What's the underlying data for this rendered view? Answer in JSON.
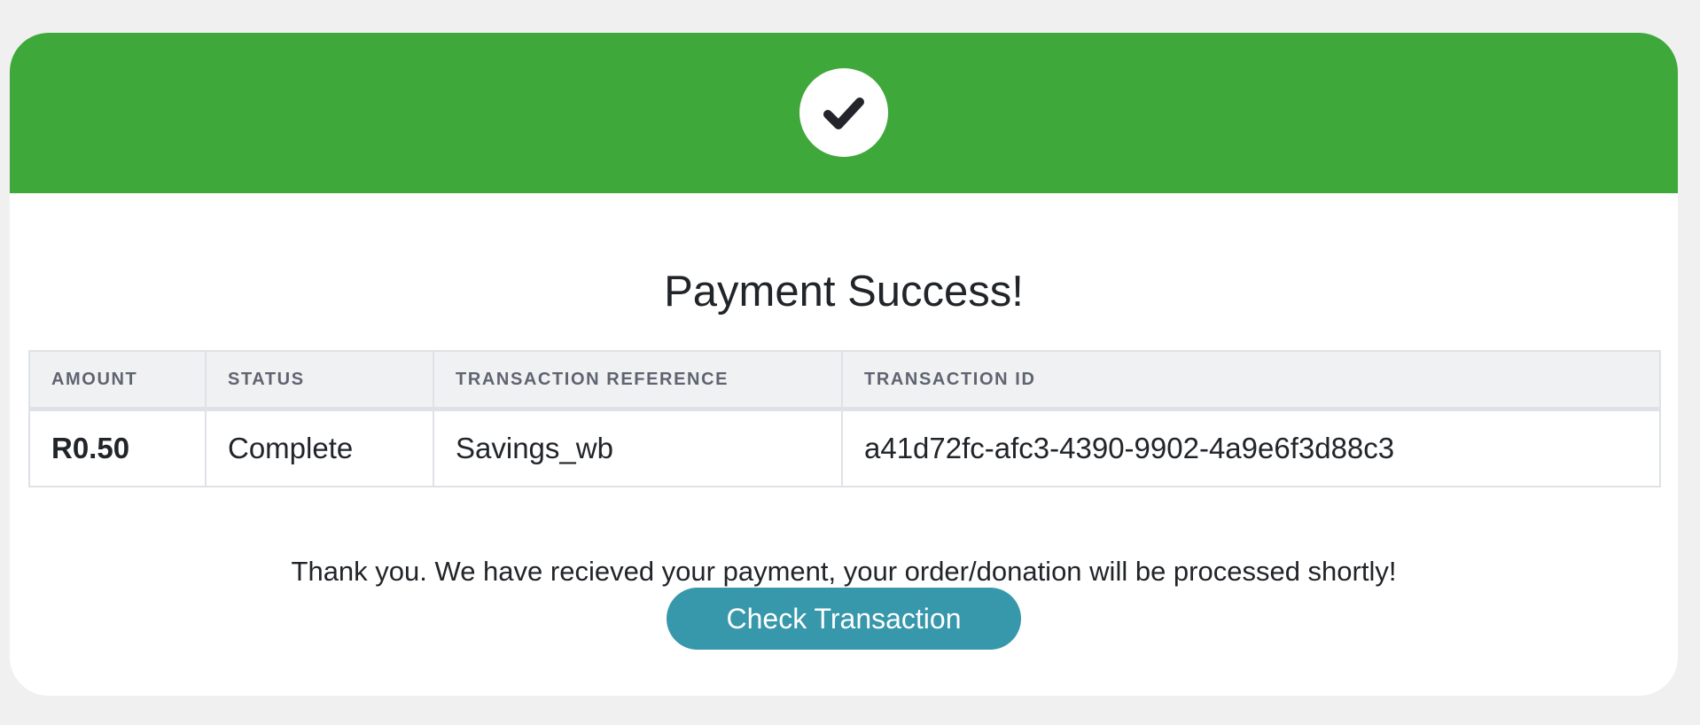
{
  "header": {
    "icon": "checkmark-icon",
    "banner_color": "#3ea83a"
  },
  "title": "Payment Success!",
  "table": {
    "headers": [
      "AMOUNT",
      "STATUS",
      "TRANSACTION REFERENCE",
      "TRANSACTION ID"
    ],
    "row": {
      "amount": "R0.50",
      "status": "Complete",
      "reference": "Savings_wb",
      "transaction_id": "a41d72fc-afc3-4390-9902-4a9e6f3d88c3"
    }
  },
  "message": "Thank you. We have recieved your payment, your order/donation will be processed shortly!",
  "button": {
    "label": "Check Transaction",
    "color": "#3797ab"
  }
}
